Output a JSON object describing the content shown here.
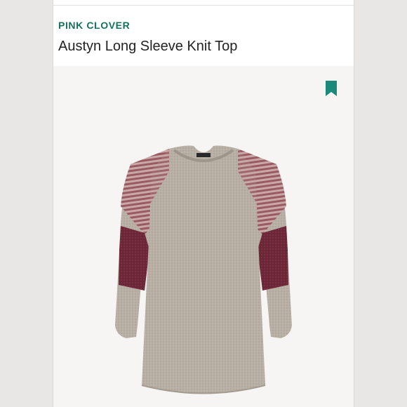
{
  "product": {
    "brand": "PINK CLOVER",
    "title": "Austyn Long Sleeve Knit Top"
  },
  "icons": {
    "bookmark": "bookmark-icon"
  },
  "colors": {
    "brand": "#14725f",
    "bookmark": "#1b8a7a",
    "body_knit": "#b5aca2",
    "stripe": "#9a5a62",
    "sleeve_band": "#6b2738"
  }
}
